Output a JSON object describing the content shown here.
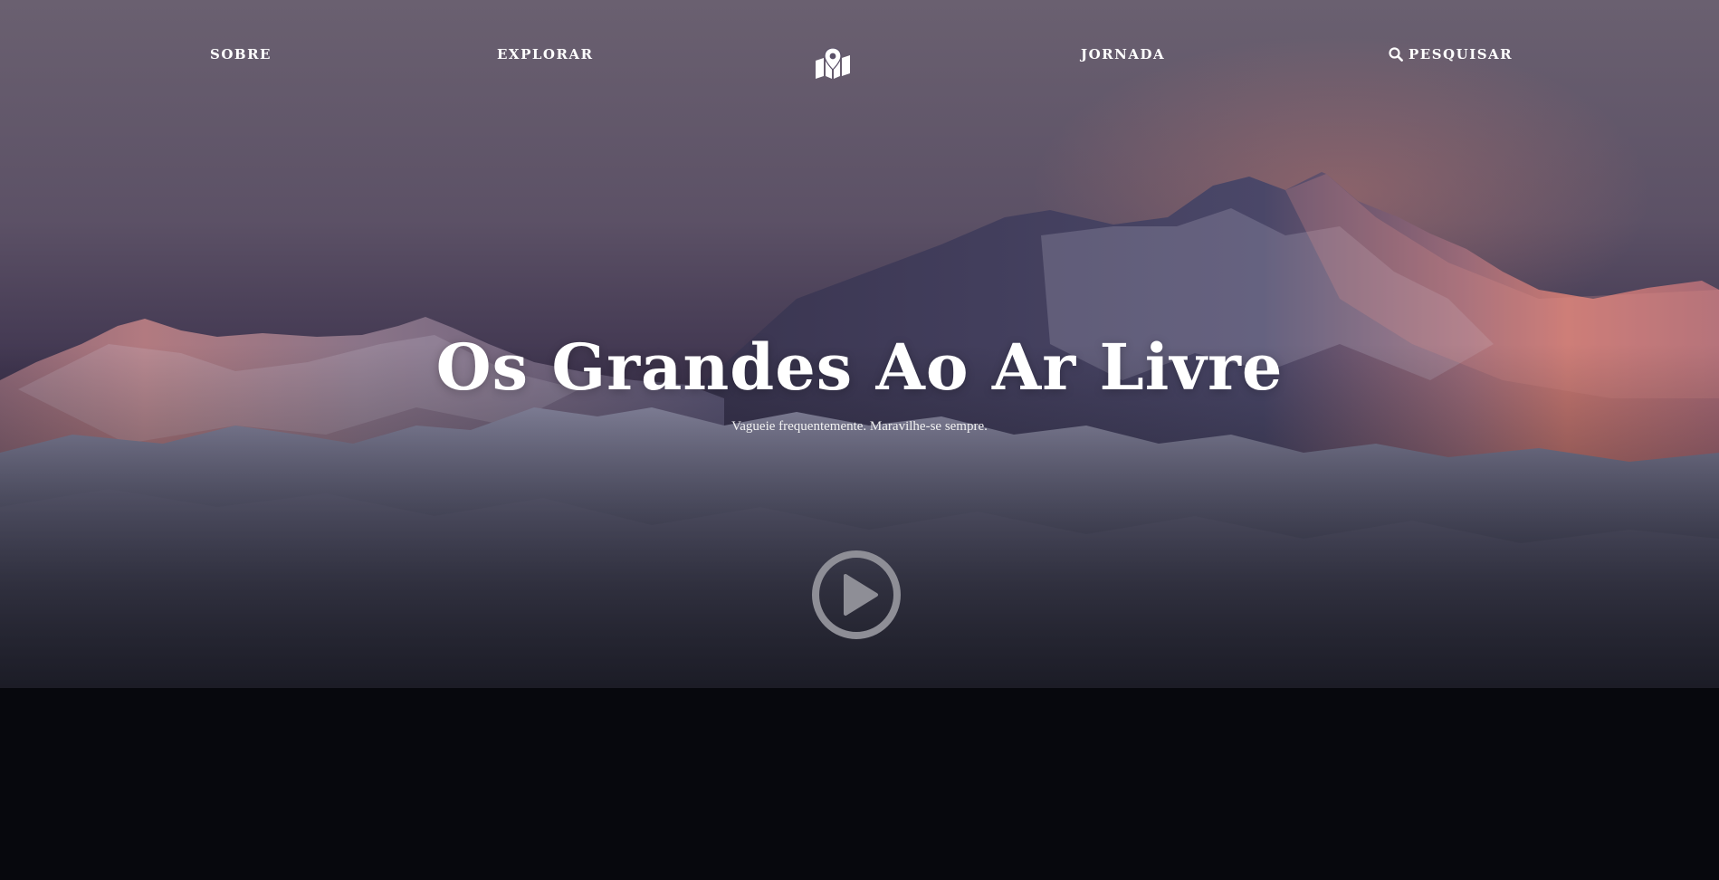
{
  "nav": {
    "items": [
      {
        "label": "SOBRE"
      },
      {
        "label": "EXPLORAR"
      },
      {
        "label": "JORNADA"
      },
      {
        "label": "PESQUISAR",
        "icon": "search-icon"
      }
    ],
    "logo_icon": "map-marker-icon"
  },
  "hero": {
    "title": "Os Grandes Ao Ar Livre",
    "subtitle": "Vagueie frequentemente. Maravilhe-se sempre.",
    "play_icon": "play-circle-icon",
    "background": "mountain-range-at-dusk"
  },
  "colors": {
    "sky_top": "#6a6070",
    "sky_mid": "#4e4258",
    "peak_glow": "#d47a6e",
    "snow": "#b8b6c8",
    "ground": "#07080d",
    "text": "#ffffff"
  }
}
